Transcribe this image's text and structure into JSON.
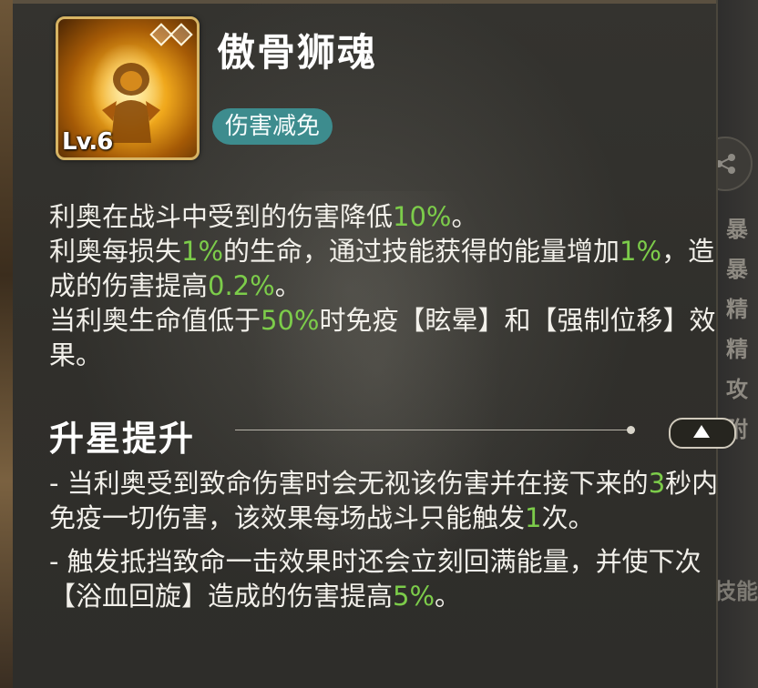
{
  "skill": {
    "name": "傲骨狮魂",
    "level_label": "Lv.6",
    "tag": "伤害减免",
    "icon": "golden-lion-warrior-icon",
    "star_count": 2
  },
  "description": {
    "line1": {
      "a": "利奥在战斗中受到的伤害降低",
      "v1": "10%",
      "b": "。"
    },
    "line2": {
      "a": "利奥每损失",
      "v1": "1%",
      "b": "的生命，通过技能获得的能量增加",
      "v2": "1%",
      "c": "，造成的伤害提高",
      "v3": "0.2%",
      "d": "。"
    },
    "line3": {
      "a": "当利奥生命值低于",
      "v1": "50%",
      "b": "时免疫【眩晕】和【强制位移】效果。"
    }
  },
  "star_upgrade": {
    "title": "升星提升",
    "items": [
      {
        "a": "- 当利奥受到致命伤害时会无视该伤害并在接下来的",
        "v1": "3",
        "b": "秒内免疫一切伤害，该效果每场战斗只能触发",
        "v2": "1",
        "c": "次。"
      },
      {
        "a": "- 触发抵挡致命一击效果时还会立刻回满能量，并使下次【浴血回旋】造成的伤害提高",
        "v1": "5%",
        "b": "。"
      }
    ]
  },
  "side_panel": {
    "chars": [
      "暴",
      "暴",
      "精",
      "精",
      "攻",
      "附"
    ],
    "bottom_label": "技能"
  },
  "colors": {
    "highlight": "#7ccc4a",
    "tag_bg": "#3d8c8e",
    "icon_border": "#d7b464"
  }
}
